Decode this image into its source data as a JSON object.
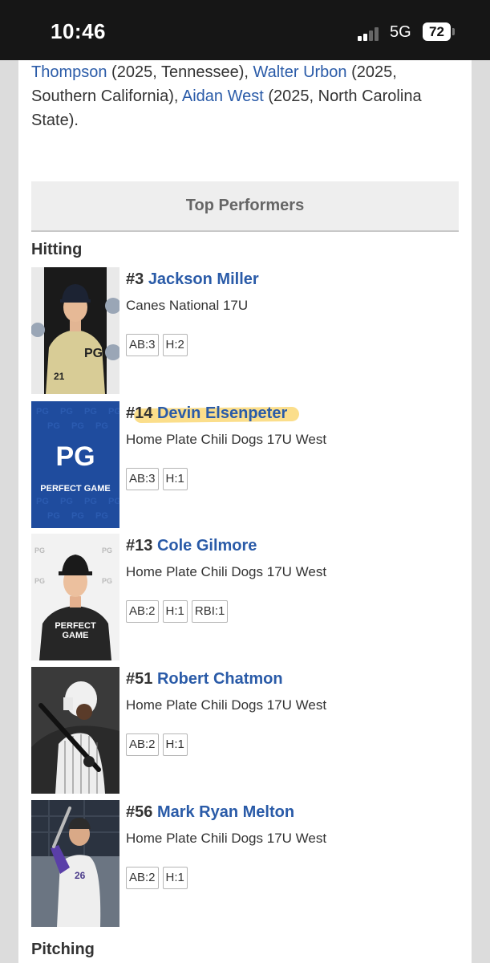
{
  "status_bar": {
    "time": "10:46",
    "network": "5G",
    "battery": "72"
  },
  "intro": {
    "seg1": "Thompson",
    "seg2": " (2025, Tennessee), ",
    "seg3": "Walter Urbon",
    "seg4": " (2025, Southern California), ",
    "seg5": "Aidan West",
    "seg6": " (2025, North Carolina State)."
  },
  "top_performers": {
    "title": "Top Performers"
  },
  "hitting": {
    "title": "Hitting",
    "players": [
      {
        "number": "#3",
        "name": "Jackson Miller",
        "team": "Canes National 17U",
        "stats": [
          "AB:3",
          "H:2"
        ]
      },
      {
        "number": "#14",
        "name": "Devin Elsenpeter",
        "team": "Home Plate Chili Dogs 17U West",
        "stats": [
          "AB:3",
          "H:1"
        ],
        "placeholder_text": "PERFECT GAME"
      },
      {
        "number": "#13",
        "name": "Cole Gilmore",
        "team": "Home Plate Chili Dogs 17U West",
        "stats": [
          "AB:2",
          "H:1",
          "RBI:1"
        ]
      },
      {
        "number": "#51",
        "name": "Robert Chatmon",
        "team": "Home Plate Chili Dogs 17U West",
        "stats": [
          "AB:2",
          "H:1"
        ]
      },
      {
        "number": "#56",
        "name": "Mark Ryan Melton",
        "team": "Home Plate Chili Dogs 17U West",
        "stats": [
          "AB:2",
          "H:1"
        ]
      }
    ]
  },
  "pitching": {
    "title": "Pitching"
  },
  "colors": {
    "link": "#2a5ba8",
    "pg_blue": "#1f4c9e",
    "highlight": "#fad66e"
  }
}
